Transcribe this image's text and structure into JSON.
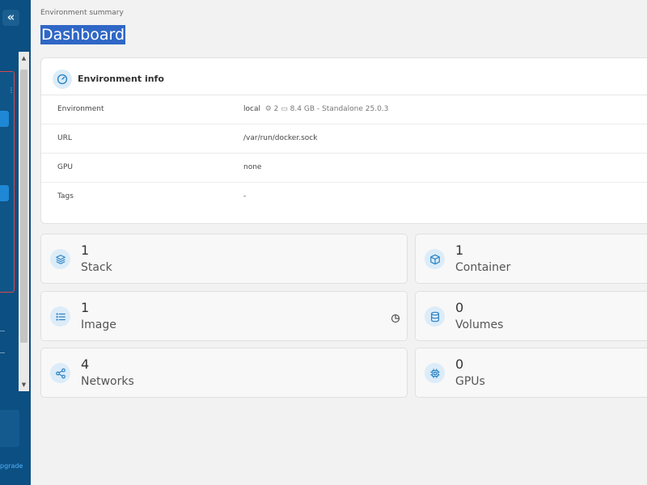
{
  "sidebar": {
    "collapse_glyph": "«",
    "upgrade_text": "pgrade",
    "scroll_up": "▲",
    "scroll_down": "▼"
  },
  "header": {
    "breadcrumb": "Environment summary",
    "title": "Dashboard"
  },
  "environment_info": {
    "title": "Environment info",
    "rows": {
      "environment": {
        "label": "Environment",
        "name": "local",
        "cpu": "2",
        "memory": "8.4 GB",
        "suffix": "- Standalone 25.0.3"
      },
      "url": {
        "label": "URL",
        "value": "/var/run/docker.sock"
      },
      "gpu": {
        "label": "GPU",
        "value": "none"
      },
      "tags": {
        "label": "Tags",
        "value": "-"
      }
    }
  },
  "cards": {
    "stack": {
      "count": "1",
      "label": "Stack",
      "icon": "layers-icon"
    },
    "container": {
      "count": "1",
      "label": "Container",
      "icon": "cube-icon"
    },
    "image": {
      "count": "1",
      "label": "Image",
      "icon": "list-icon"
    },
    "volumes": {
      "count": "0",
      "label": "Volumes",
      "icon": "database-icon"
    },
    "networks": {
      "count": "4",
      "label": "Networks",
      "icon": "share-icon"
    },
    "gpus": {
      "count": "0",
      "label": "GPUs",
      "icon": "chip-icon"
    }
  },
  "colors": {
    "sidebar_bg": "#0c4f82",
    "accent": "#2b83c5",
    "title_highlight": "#2f67c6",
    "env_box_border": "#d94a4a"
  }
}
